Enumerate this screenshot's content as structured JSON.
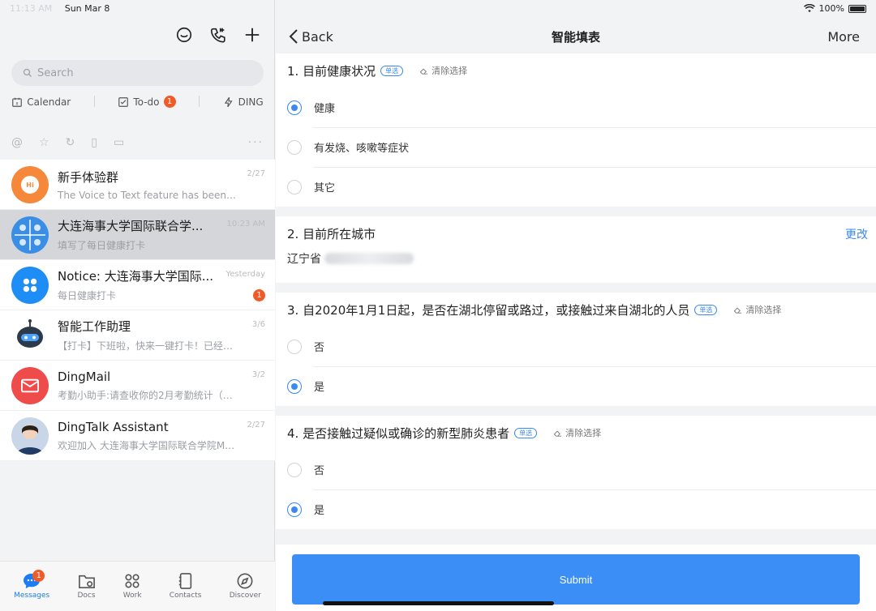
{
  "status": {
    "time": "11:13 AM",
    "date": "Sun Mar 8",
    "battery": "100%"
  },
  "sidebar": {
    "search_placeholder": "Search",
    "quick": [
      {
        "label": "Calendar"
      },
      {
        "label": "To-do",
        "badge": "1"
      },
      {
        "label": "DING"
      }
    ],
    "conversations": [
      {
        "title": "新手体验群",
        "subtitle": "The Voice to Text feature has been ...",
        "time": "2/27",
        "avatar_color": "#f5883a"
      },
      {
        "title": "大连海事大学国际联合学...",
        "subtitle": "填写了每日健康打卡",
        "time": "10:23 AM",
        "avatar_color": "#3a8ee6",
        "active": true
      },
      {
        "title": "Notice: 大连海事大学国际...",
        "subtitle": "每日健康打卡",
        "time": "Yesterday",
        "avatar_color": "#1e8df5",
        "badge": "1"
      },
      {
        "title": "智能工作助理",
        "subtitle": "【打卡】下班啦，快来一键打卡！已经下班...",
        "time": "3/6",
        "avatar_color": "#ffffff"
      },
      {
        "title": "DingMail",
        "subtitle": "考勤小助手:请查收你的2月考勤统计（大连...",
        "time": "3/2",
        "avatar_color": "#f04b4b"
      },
      {
        "title": "DingTalk Assistant",
        "subtitle": "欢迎加入 大连海事大学国际联合学院MSE...",
        "time": "2/27",
        "avatar_color": "#c9d6e8"
      }
    ],
    "tabs": [
      {
        "label": "Messages",
        "badge": "1",
        "icon": "chat-bubble-icon",
        "active": true
      },
      {
        "label": "Docs",
        "icon": "folder-icon"
      },
      {
        "label": "Work",
        "icon": "grid-icon"
      },
      {
        "label": "Contacts",
        "icon": "contacts-book-icon"
      },
      {
        "label": "Discover",
        "icon": "compass-icon"
      }
    ]
  },
  "main": {
    "back_label": "Back",
    "title": "智能填表",
    "more_label": "More",
    "single_tag": "单选",
    "clear_label": "清除选择",
    "q1": {
      "title": "1. 目前健康状况",
      "options": [
        "健康",
        "有发烧、咳嗽等症状",
        "其它"
      ],
      "selected": 0
    },
    "q2": {
      "title": "2. 目前所在城市",
      "value": "辽宁省",
      "edit_label": "更改"
    },
    "q3": {
      "title": "3. 自2020年1月1日起，是否在湖北停留或路过，或接触过来自湖北的人员",
      "options": [
        "否",
        "是"
      ],
      "selected": 1
    },
    "q4": {
      "title": "4. 是否接触过疑似或确诊的新型肺炎患者",
      "options": [
        "否",
        "是"
      ],
      "selected": 1
    },
    "submit_label": "Submit"
  }
}
